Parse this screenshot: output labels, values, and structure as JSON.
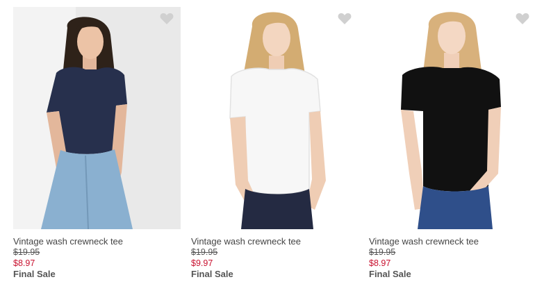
{
  "colors": {
    "sale_price": "#c8102e",
    "favorite_icon": "#d0d0d0",
    "text": "#444444"
  },
  "products": [
    {
      "name": "Vintage wash crewneck tee",
      "original_price": "$19.95",
      "sale_price": "$8.97",
      "badge": "Final Sale",
      "tee_color": "navy",
      "favorite_icon": "heart-icon"
    },
    {
      "name": "Vintage wash crewneck tee",
      "original_price": "$19.95",
      "sale_price": "$9.97",
      "badge": "Final Sale",
      "tee_color": "white",
      "favorite_icon": "heart-icon"
    },
    {
      "name": "Vintage wash crewneck tee",
      "original_price": "$19.95",
      "sale_price": "$8.97",
      "badge": "Final Sale",
      "tee_color": "black",
      "favorite_icon": "heart-icon"
    }
  ]
}
